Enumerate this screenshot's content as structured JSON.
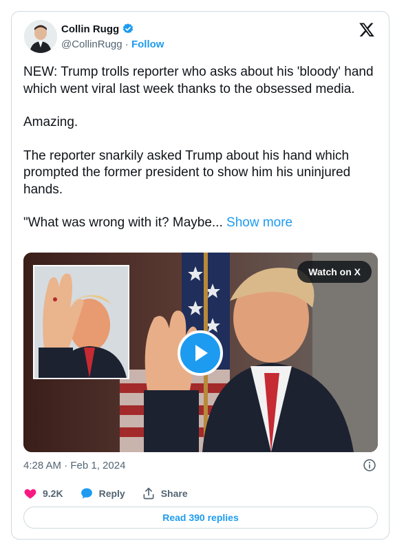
{
  "author": {
    "name": "Collin Rugg",
    "handle": "@CollinRugg",
    "separator": "·",
    "follow_label": "Follow",
    "verified": true
  },
  "post": {
    "paragraphs": [
      "NEW: Trump trolls reporter who asks about his 'bloody' hand which went viral last week thanks to the obsessed media.",
      "Amazing.",
      "The reporter snarkily asked Trump about his hand which prompted the former president to show him his uninjured hands."
    ],
    "truncated_line": "\"What was wrong with it? Maybe...",
    "show_more_label": "Show more"
  },
  "media": {
    "watch_label": "Watch on X"
  },
  "meta": {
    "timestamp": "4:28 AM · Feb 1, 2024"
  },
  "actions": {
    "like_count": "9.2K",
    "reply_label": "Reply",
    "share_label": "Share",
    "read_replies_label": "Read 390 replies"
  },
  "colors": {
    "accent": "#1d9bf0",
    "like": "#f91880",
    "muted": "#536471",
    "border": "#cfd9de"
  },
  "icons": {
    "verified": "verified-badge-icon",
    "logo": "x-logo-icon",
    "info": "info-icon",
    "like": "heart-icon",
    "reply": "reply-bubble-icon",
    "share": "share-icon",
    "play": "play-icon"
  }
}
